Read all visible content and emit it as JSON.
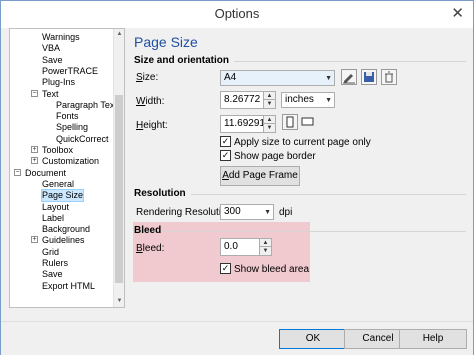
{
  "window": {
    "title": "Options",
    "close_icon": "close-icon"
  },
  "tree": {
    "items": [
      {
        "label": "Warnings",
        "level": 2
      },
      {
        "label": "VBA",
        "level": 2
      },
      {
        "label": "Save",
        "level": 2
      },
      {
        "label": "PowerTRACE",
        "level": 2
      },
      {
        "label": "Plug-Ins",
        "level": 2
      },
      {
        "label": "Text",
        "level": 2,
        "expander": "−"
      },
      {
        "label": "Paragraph Tex",
        "level": 3
      },
      {
        "label": "Fonts",
        "level": 3
      },
      {
        "label": "Spelling",
        "level": 3
      },
      {
        "label": "QuickCorrect",
        "level": 3
      },
      {
        "label": "Toolbox",
        "level": 2,
        "expander": "+"
      },
      {
        "label": "Customization",
        "level": 2,
        "expander": "+"
      },
      {
        "label": "Document",
        "level": 1,
        "expander": "−"
      },
      {
        "label": "General",
        "level": 2
      },
      {
        "label": "Page Size",
        "level": 2,
        "selected": true
      },
      {
        "label": "Layout",
        "level": 2
      },
      {
        "label": "Label",
        "level": 2
      },
      {
        "label": "Background",
        "level": 2
      },
      {
        "label": "Guidelines",
        "level": 2,
        "expander": "+"
      },
      {
        "label": "Grid",
        "level": 2
      },
      {
        "label": "Rulers",
        "level": 2
      },
      {
        "label": "Save",
        "level": 2
      },
      {
        "label": "Export HTML",
        "level": 2
      }
    ]
  },
  "panel": {
    "title": "Page Size",
    "size_orientation": {
      "heading": "Size and orientation",
      "size_label": "Size:",
      "size_value": "A4",
      "width_label": "Width:",
      "width_value": "8.26772",
      "units_value": "inches",
      "height_label": "Height:",
      "height_value": "11.69291",
      "apply_current_label": "Apply size to current page only",
      "apply_current_checked": true,
      "show_border_label": "Show page border",
      "show_border_checked": true,
      "add_frame_label": "Add Page Frame"
    },
    "resolution": {
      "heading": "Resolution",
      "rendering_label": "Rendering Resolution:",
      "rendering_value": "300",
      "unit": "dpi"
    },
    "bleed": {
      "heading": "Bleed",
      "bleed_label": "Bleed:",
      "bleed_value": "0.0",
      "show_bleed_label": "Show bleed area",
      "show_bleed_checked": true,
      "highlight_color": "#f196a0"
    }
  },
  "buttons": {
    "ok": "OK",
    "cancel": "Cancel",
    "help": "Help"
  }
}
